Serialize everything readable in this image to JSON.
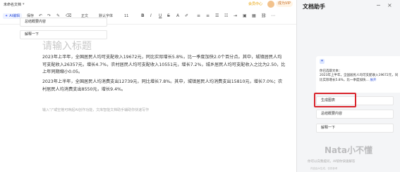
{
  "titlebar": {
    "doc_title": "未命名文档",
    "edit_icon": "▾",
    "sale_label": "会员中心",
    "vip_label": "成为VIP"
  },
  "toolbar": {
    "ai_label": "AI编辑",
    "save_label": "保存",
    "text_style": "正文",
    "font": "默认字体",
    "font_size": "11"
  },
  "editor": {
    "title_placeholder": "请输入标题",
    "paragraph1": "2023年上半年，全国居民人均可支配收入19672元，同比实际增长5.8%，比一季度加快2.0个百分点。其中，城镇居民人均可支配收入26357元，增长4.7%，农村居民人均可支配收入10551元，增长7.2%，城乡居民人均可支配收入之比为2.50，比上年同期缩小0.05。",
    "paragraph2": "2023年上半年，全国居民人均消费支出12739元，同比增长7.8%。其中，城镇居民人均消费支出15810元，增长7.0%；农村居民人均消费支出8550元，增长9.4%。",
    "ai_hint": "输入\"/\"或空格可唤起AI创作功能，文库智能文档助手辅助你快速写作"
  },
  "panel": {
    "title": "文档助手",
    "actions_top": [
      "总结概要内容",
      "解释一下"
    ],
    "chat_intro": "你已选取文本：",
    "chat_quote": "2023年上半年，全国居民人均可支配收入19672元，同比实际增长5.8%，比一季度加快…",
    "expand_label": "展开",
    "actions_bottom": [
      "生成图表",
      "总结概要内容",
      "解释一下"
    ],
    "watermark": "Nata小不懂",
    "input_placeholder": "你可以向我提问，AI帮你快速解答",
    "disclaimer": "内容由AI生成，仅供参考"
  }
}
